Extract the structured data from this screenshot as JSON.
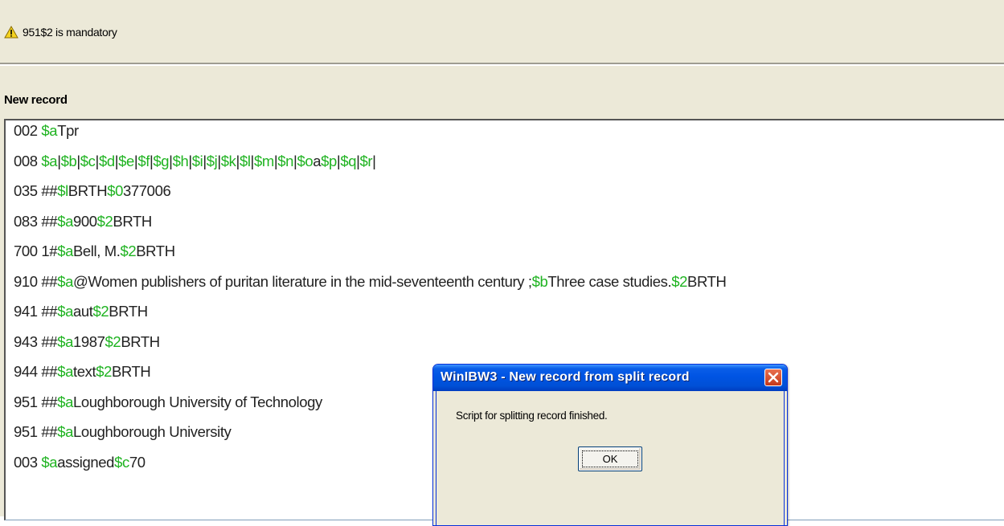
{
  "status": {
    "icon": "warning-icon",
    "message": "951$2 is mandatory"
  },
  "panel": {
    "title": "New record"
  },
  "record_lines": [
    [
      {
        "t": "002 "
      },
      {
        "t": "$a",
        "sf": true
      },
      {
        "t": "Tpr"
      }
    ],
    [
      {
        "t": "008 "
      },
      {
        "t": "$a",
        "sf": true
      },
      {
        "t": "|"
      },
      {
        "t": "$b",
        "sf": true
      },
      {
        "t": "|"
      },
      {
        "t": "$c",
        "sf": true
      },
      {
        "t": "|"
      },
      {
        "t": "$d",
        "sf": true
      },
      {
        "t": "|"
      },
      {
        "t": "$e",
        "sf": true
      },
      {
        "t": "|"
      },
      {
        "t": "$f",
        "sf": true
      },
      {
        "t": "|"
      },
      {
        "t": "$g",
        "sf": true
      },
      {
        "t": "|"
      },
      {
        "t": "$h",
        "sf": true
      },
      {
        "t": "|"
      },
      {
        "t": "$i",
        "sf": true
      },
      {
        "t": "|"
      },
      {
        "t": "$j",
        "sf": true
      },
      {
        "t": "|"
      },
      {
        "t": "$k",
        "sf": true
      },
      {
        "t": "|"
      },
      {
        "t": "$l",
        "sf": true
      },
      {
        "t": "|"
      },
      {
        "t": "$m",
        "sf": true
      },
      {
        "t": "|"
      },
      {
        "t": "$n",
        "sf": true
      },
      {
        "t": "|"
      },
      {
        "t": "$o",
        "sf": true
      },
      {
        "t": "a"
      },
      {
        "t": "$p",
        "sf": true
      },
      {
        "t": "|"
      },
      {
        "t": "$q",
        "sf": true
      },
      {
        "t": "|"
      },
      {
        "t": "$r",
        "sf": true
      },
      {
        "t": "|"
      }
    ],
    [
      {
        "t": "035 ##"
      },
      {
        "t": "$l",
        "sf": true
      },
      {
        "t": "BRTH"
      },
      {
        "t": "$0",
        "sf": true
      },
      {
        "t": "377006"
      }
    ],
    [
      {
        "t": "083 ##"
      },
      {
        "t": "$a",
        "sf": true
      },
      {
        "t": "900"
      },
      {
        "t": "$2",
        "sf": true
      },
      {
        "t": "BRTH"
      }
    ],
    [
      {
        "t": "700 1#"
      },
      {
        "t": "$a",
        "sf": true
      },
      {
        "t": "Bell, M."
      },
      {
        "t": "$2",
        "sf": true
      },
      {
        "t": "BRTH"
      }
    ],
    [
      {
        "t": "910 ##"
      },
      {
        "t": "$a",
        "sf": true
      },
      {
        "t": "@Women publishers of puritan literature in the mid-seventeenth century ;"
      },
      {
        "t": "$b",
        "sf": true
      },
      {
        "t": "Three case studies."
      },
      {
        "t": "$2",
        "sf": true
      },
      {
        "t": "BRTH"
      }
    ],
    [
      {
        "t": "941 ##"
      },
      {
        "t": "$a",
        "sf": true
      },
      {
        "t": "aut"
      },
      {
        "t": "$2",
        "sf": true
      },
      {
        "t": "BRTH"
      }
    ],
    [
      {
        "t": "943 ##"
      },
      {
        "t": "$a",
        "sf": true
      },
      {
        "t": "1987"
      },
      {
        "t": "$2",
        "sf": true
      },
      {
        "t": "BRTH"
      }
    ],
    [
      {
        "t": "944 ##"
      },
      {
        "t": "$a",
        "sf": true
      },
      {
        "t": "text"
      },
      {
        "t": "$2",
        "sf": true
      },
      {
        "t": "BRTH"
      }
    ],
    [
      {
        "t": "951 ##"
      },
      {
        "t": "$a",
        "sf": true
      },
      {
        "t": "Loughborough University of Technology"
      }
    ],
    [
      {
        "t": "951 ##"
      },
      {
        "t": "$a",
        "sf": true
      },
      {
        "t": "Loughborough University"
      }
    ],
    [
      {
        "t": "003 "
      },
      {
        "t": "$a",
        "sf": true
      },
      {
        "t": "assigned"
      },
      {
        "t": "$c",
        "sf": true
      },
      {
        "t": "70"
      }
    ]
  ],
  "dialog": {
    "title": "WinIBW3 - New record from split record",
    "message": "Script for splitting record finished.",
    "ok_label": "OK",
    "close_icon": "close-icon"
  },
  "colors": {
    "subfield": "#1fb321",
    "chrome": "#ece9d8",
    "titlebar": "#0054e3"
  }
}
